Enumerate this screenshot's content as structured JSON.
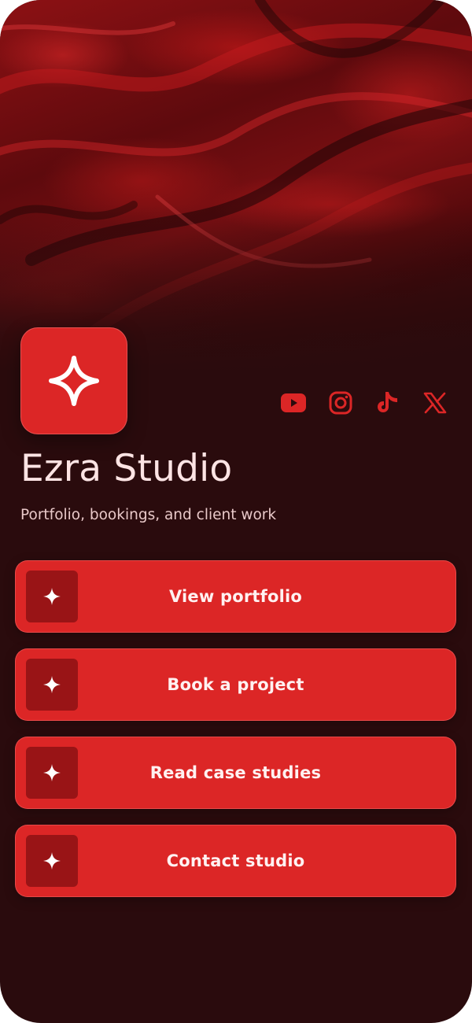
{
  "profile": {
    "name": "Ezra Studio",
    "tagline": "Portfolio, bookings, and client work",
    "avatar_icon": "sparkle-icon"
  },
  "socials": [
    {
      "name": "youtube-icon"
    },
    {
      "name": "instagram-icon"
    },
    {
      "name": "tiktok-icon"
    },
    {
      "name": "x-icon"
    }
  ],
  "links": [
    {
      "label": "View portfolio",
      "icon": "sparkle-icon"
    },
    {
      "label": "Book a project",
      "icon": "sparkle-icon"
    },
    {
      "label": "Read case studies",
      "icon": "sparkle-icon"
    },
    {
      "label": "Contact studio",
      "icon": "sparkle-icon"
    }
  ],
  "colors": {
    "background": "#2a0b0d",
    "accent": "#dc2626",
    "accent_dark": "#991416",
    "text": "#fde4e4"
  }
}
